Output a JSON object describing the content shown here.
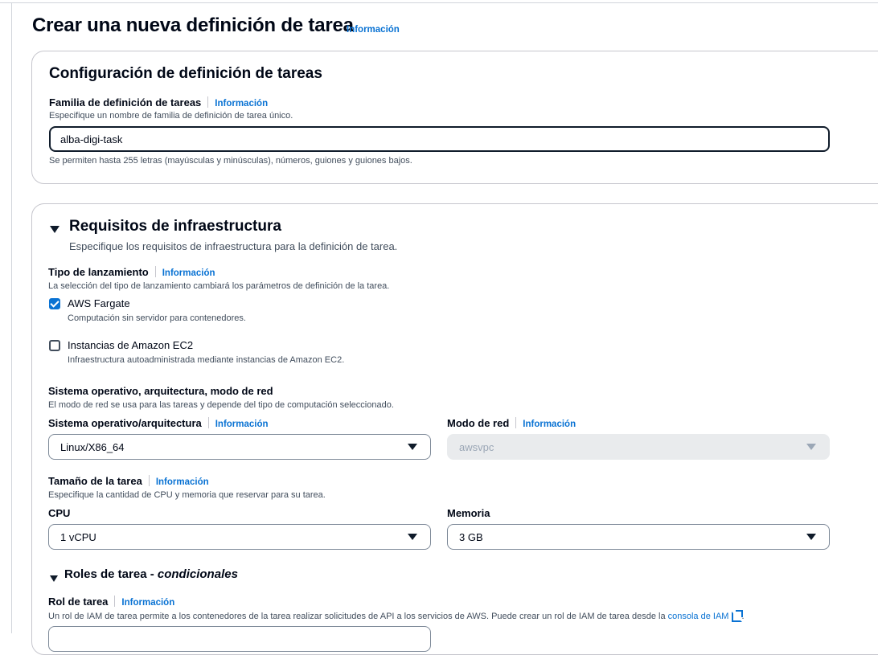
{
  "page": {
    "title": "Crear una nueva definición de tarea",
    "info": "Información"
  },
  "config": {
    "heading": "Configuración de definición de tareas",
    "family_label": "Familia de definición de tareas",
    "family_info": "Información",
    "family_desc": "Especifique un nombre de familia de definición de tarea único.",
    "family_value": "alba-digi-task",
    "family_constraint": "Se permiten hasta 255 letras (mayúsculas y minúsculas), números, guiones y guiones bajos."
  },
  "infra": {
    "heading": "Requisitos de infraestructura",
    "desc": "Especifique los requisitos de infraestructura para la definición de tarea.",
    "launch_label": "Tipo de lanzamiento",
    "launch_info": "Información",
    "launch_desc": "La selección del tipo de lanzamiento cambiará los parámetros de definición de la tarea.",
    "options": [
      {
        "label": "AWS Fargate",
        "desc": "Computación sin servidor para contenedores.",
        "checked": true
      },
      {
        "label": "Instancias de Amazon EC2",
        "desc": "Infraestructura autoadministrada mediante instancias de Amazon EC2.",
        "checked": false
      }
    ],
    "os_section_label": "Sistema operativo, arquitectura, modo de red",
    "os_section_desc": "El modo de red se usa para las tareas y depende del tipo de computación seleccionado.",
    "os_label": "Sistema operativo/arquitectura",
    "os_info": "Información",
    "os_value": "Linux/X86_64",
    "network_label": "Modo de red",
    "network_info": "Información",
    "network_value": "awsvpc",
    "size_label": "Tamaño de la tarea",
    "size_info": "Información",
    "size_desc": "Especifique la cantidad de CPU y memoria que reservar para su tarea.",
    "cpu_label": "CPU",
    "cpu_value": "1 vCPU",
    "memory_label": "Memoria",
    "memory_value": "3 GB",
    "roles_heading": "Roles de tarea",
    "roles_dash": " - ",
    "roles_conditional": "condicionales",
    "task_role_label": "Rol de tarea",
    "task_role_info": "Información",
    "task_role_desc": "Un rol de IAM de tarea permite a los contenedores de la tarea realizar solicitudes de API a los servicios de AWS. Puede crear un rol de IAM de tarea desde la ",
    "iam_console_link": "consola de IAM",
    "task_role_desc_end": "."
  },
  "colors": {
    "link": "#0972d3",
    "text": "#000716",
    "border": "#c6c6cd",
    "disabled_bg": "#e9ebed"
  },
  "icons": [
    "external-link-icon",
    "caret-down-icon",
    "expand-triangle-icon",
    "checkmark-icon"
  ]
}
